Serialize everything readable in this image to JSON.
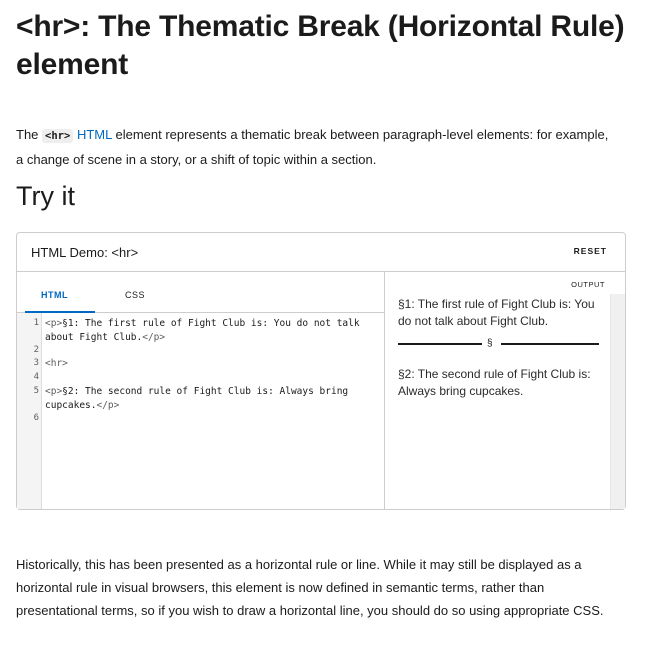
{
  "article": {
    "title": "<hr>: The Thematic Break (Horizontal Rule) element",
    "intro_prefix": "The",
    "intro_code": "<hr>",
    "intro_link": "HTML",
    "intro_rest": "element represents a thematic break between paragraph-level elements: for example, a change of scene in a story, or a shift of topic within a section.",
    "tryit_heading": "Try it",
    "outro": "Historically, this has been presented as a horizontal rule or line. While it may still be displayed as a horizontal rule in visual browsers, this element is now defined in semantic terms, rather than presentational terms, so if you wish to draw a horizontal line, you should do so using appropriate CSS."
  },
  "demo": {
    "title": "HTML Demo: <hr>",
    "reset_label": "RESET",
    "tabs": [
      {
        "label": "HTML",
        "active": true
      },
      {
        "label": "CSS",
        "active": false
      }
    ],
    "code_lines": [
      {
        "num": "1",
        "open": "<p>",
        "text": "§1: The first rule of Fight Club is: You do not talk about Fight Club.",
        "close": "</p>"
      },
      {
        "num": "2",
        "open": "",
        "text": "",
        "close": ""
      },
      {
        "num": "3",
        "open": "<hr>",
        "text": "",
        "close": ""
      },
      {
        "num": "4",
        "open": "",
        "text": "",
        "close": ""
      },
      {
        "num": "5",
        "open": "<p>",
        "text": "§2: The second rule of Fight Club is: Always bring cupcakes.",
        "close": "</p>"
      },
      {
        "num": "6",
        "open": "",
        "text": "",
        "close": ""
      }
    ],
    "output_label": "OUTPUT",
    "output_p1": "§1: The first rule of Fight Club is: You do not talk about Fight Club.",
    "output_hr_symbol": "§",
    "output_p2": "§2: The second rule of Fight Club is: Always bring cupcakes."
  },
  "colors": {
    "link": "#0069c2",
    "border": "#cdcdcd",
    "text": "#1b1b1b"
  }
}
